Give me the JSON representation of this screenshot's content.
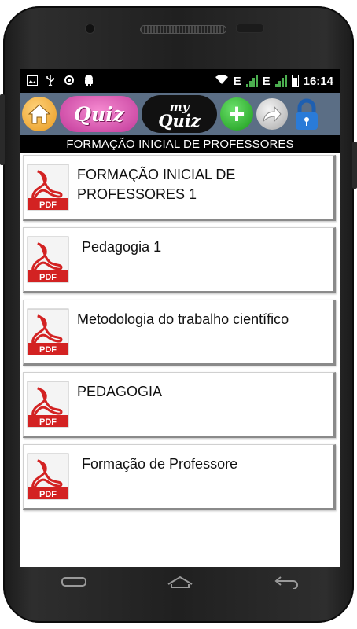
{
  "status_bar": {
    "left_icons": [
      "image-icon",
      "usb-icon",
      "sync-icon",
      "android-icon"
    ],
    "right_icons": [
      "wifi-icon",
      "signal-icon",
      "signal-icon",
      "battery-icon"
    ],
    "network_label_1": "E",
    "network_label_2": "E",
    "time": "16:14"
  },
  "toolbar": {
    "home_icon": "home-icon",
    "quiz_label": "Quiz",
    "my_quiz_top": "my",
    "my_quiz_bottom": "Quiz",
    "add_label": "+",
    "share_icon": "share-arrow-icon",
    "lock_icon": "lock-icon",
    "bar_color": "#5b6e85"
  },
  "header": {
    "title": "FORMAÇÃO INICIAL DE PROFESSORES"
  },
  "list": {
    "items": [
      {
        "label": "FORMAÇÃO INICIAL DE PROFESSORES 1",
        "icon": "pdf-icon",
        "icon_text": "PDF"
      },
      {
        "label": "Pedagogia 1",
        "icon": "pdf-icon",
        "icon_text": "PDF"
      },
      {
        "label": "Metodologia do trabalho científico",
        "icon": "pdf-icon",
        "icon_text": "PDF"
      },
      {
        "label": "PEDAGOGIA",
        "icon": "pdf-icon",
        "icon_text": "PDF"
      },
      {
        "label": "Formação de Professore",
        "icon": "pdf-icon",
        "icon_text": "PDF"
      }
    ]
  },
  "nav_bar": {
    "buttons": [
      "back-icon",
      "home-icon",
      "recent-apps-icon"
    ]
  }
}
